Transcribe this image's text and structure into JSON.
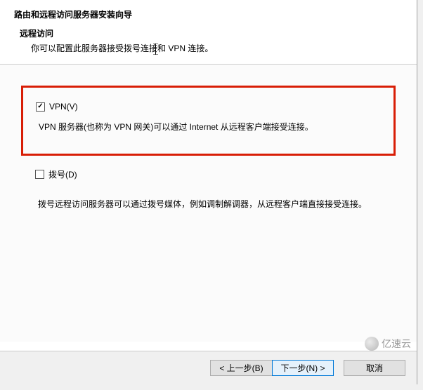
{
  "wizard": {
    "title": "路由和远程访问服务器安装向导",
    "section_title": "远程访问",
    "section_desc": "你可以配置此服务器接受拨号连接和 VPN 连接。"
  },
  "options": {
    "vpn": {
      "label": "VPN(V)",
      "checked": true,
      "desc": "VPN 服务器(也称为 VPN 网关)可以通过 Internet 从远程客户端接受连接。"
    },
    "dialup": {
      "label": "拨号(D)",
      "checked": false,
      "desc": "拨号远程访问服务器可以通过拨号媒体，例如调制解调器，从远程客户端直接接受连接。"
    }
  },
  "buttons": {
    "back": "< 上一步(B)",
    "next": "下一步(N) >",
    "cancel": "取消"
  },
  "watermark": "亿速云"
}
